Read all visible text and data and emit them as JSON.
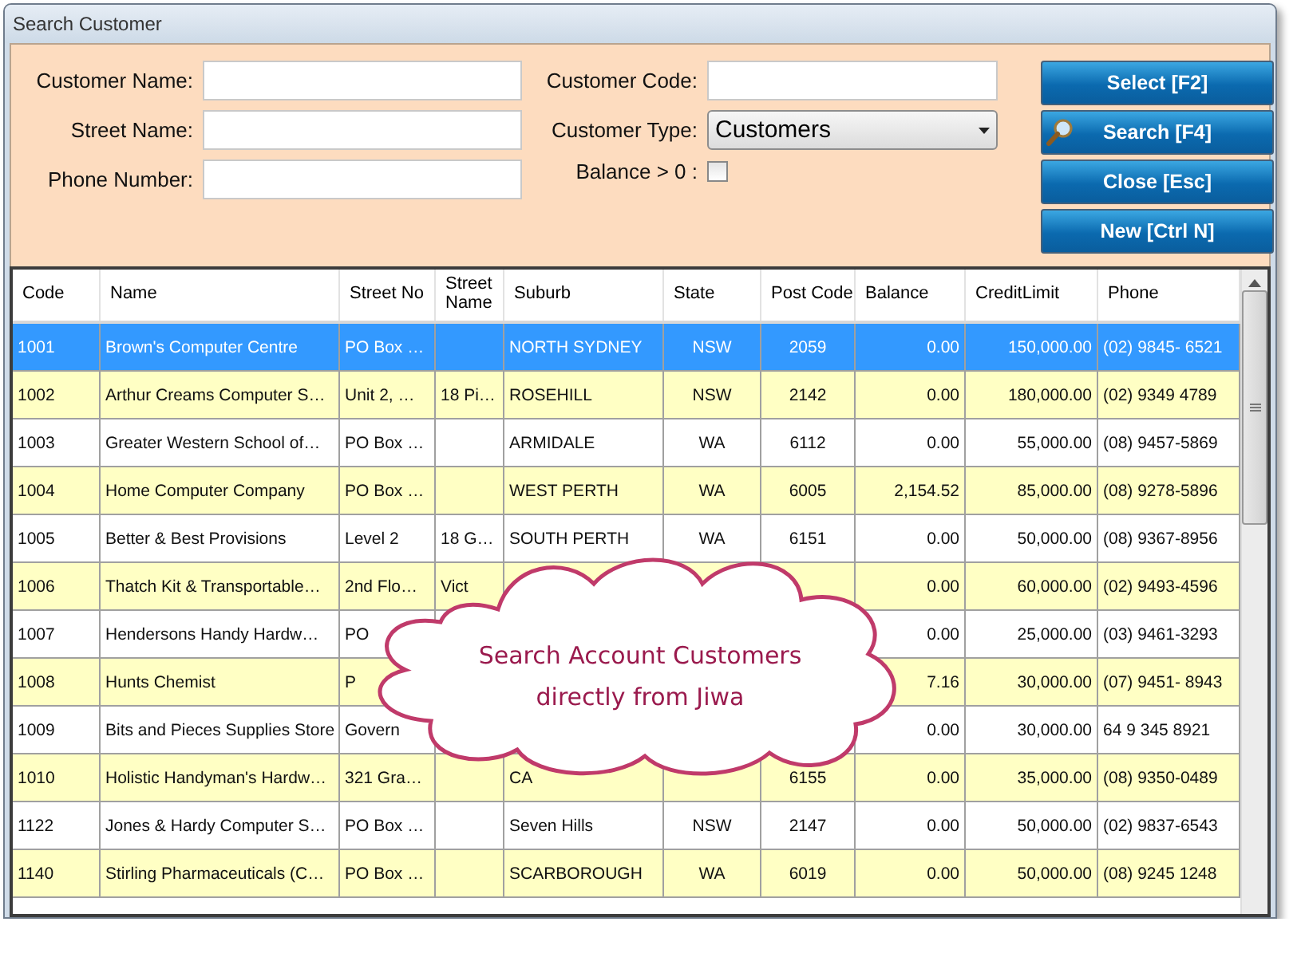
{
  "window": {
    "title": "Search Customer"
  },
  "filters": {
    "left": [
      {
        "label": "Customer Name:"
      },
      {
        "label": "Street Name:"
      },
      {
        "label": "Phone Number:"
      }
    ],
    "customer_code": {
      "label": "Customer Code:"
    },
    "customer_type": {
      "label": "Customer Type:",
      "value": "Customers"
    },
    "balance_filter": {
      "label": "Balance > 0 :",
      "checked": false
    }
  },
  "buttons": [
    {
      "label": "Select [F2]",
      "icon": false
    },
    {
      "label": "Search [F4]",
      "icon": true
    },
    {
      "label": "Close [Esc]",
      "icon": false
    },
    {
      "label": "New [Ctrl N]",
      "icon": false
    }
  ],
  "table": {
    "columns": [
      "Code",
      "Name",
      "Street No",
      "Street Name",
      "Suburb",
      "State",
      "Post Code",
      "Balance",
      "CreditLimit",
      "Phone"
    ],
    "rows": [
      {
        "selected": true,
        "cells": [
          "1001",
          "Brown's Computer Centre",
          "PO Box …",
          null,
          "NORTH SYDNEY",
          "NSW",
          "2059",
          "0.00",
          "150,000.00",
          "(02) 9845- 6521"
        ]
      },
      {
        "selected": false,
        "cells": [
          "1002",
          "Arthur Creams Computer S…",
          "Unit 2, …",
          "18 Pi…",
          "ROSEHILL",
          "NSW",
          "2142",
          "0.00",
          "180,000.00",
          "(02) 9349 4789"
        ]
      },
      {
        "selected": false,
        "cells": [
          "1003",
          "Greater Western School of…",
          "PO Box …",
          null,
          "ARMIDALE",
          "WA",
          "6112",
          "0.00",
          "55,000.00",
          "(08) 9457-5869"
        ]
      },
      {
        "selected": false,
        "cells": [
          "1004",
          "Home Computer Company",
          "PO Box …",
          null,
          "WEST PERTH",
          "WA",
          "6005",
          "2,154.52",
          "85,000.00",
          "(08) 9278-5896"
        ]
      },
      {
        "selected": false,
        "cells": [
          "1005",
          "Better & Best Provisions",
          "Level 2",
          "18 G…",
          "SOUTH PERTH",
          "WA",
          "6151",
          "0.00",
          "50,000.00",
          "(08) 9367-8956"
        ]
      },
      {
        "selected": false,
        "cells": [
          "1006",
          "Thatch Kit & Transportable…",
          "2nd Flo…",
          "Vict",
          null,
          null,
          null,
          "0.00",
          "60,000.00",
          "(02) 9493-4596"
        ]
      },
      {
        "selected": false,
        "cells": [
          "1007",
          "Hendersons Handy Hardw…",
          "PO",
          null,
          null,
          null,
          null,
          "0.00",
          "25,000.00",
          "(03) 9461-3293"
        ]
      },
      {
        "selected": false,
        "cells": [
          "1008",
          "Hunts Chemist",
          "P",
          null,
          null,
          null,
          null,
          "7.16",
          "30,000.00",
          "(07) 9451- 8943"
        ]
      },
      {
        "selected": false,
        "cells": [
          "1009",
          "Bits and Pieces Supplies Store",
          "Govern",
          null,
          null,
          null,
          null,
          "0.00",
          "30,000.00",
          "64 9 345 8921"
        ]
      },
      {
        "selected": false,
        "cells": [
          "1010",
          "Holistic Handyman's Hardw…",
          "321 Gra…",
          null,
          "CA",
          null,
          "6155",
          "0.00",
          "35,000.00",
          "(08) 9350-0489"
        ]
      },
      {
        "selected": false,
        "cells": [
          "1122",
          "Jones & Hardy Computer S…",
          "PO Box …",
          null,
          "Seven Hills",
          "NSW",
          "2147",
          "0.00",
          "50,000.00",
          "(02) 9837-6543"
        ]
      },
      {
        "selected": false,
        "cells": [
          "1140",
          "Stirling Pharmaceuticals (C…",
          "PO Box …",
          null,
          "SCARBOROUGH",
          "WA",
          "6019",
          "0.00",
          "50,000.00",
          "(08) 9245 1248"
        ]
      }
    ]
  },
  "callout": {
    "text": "Search Account Customers directly from Jiwa"
  }
}
